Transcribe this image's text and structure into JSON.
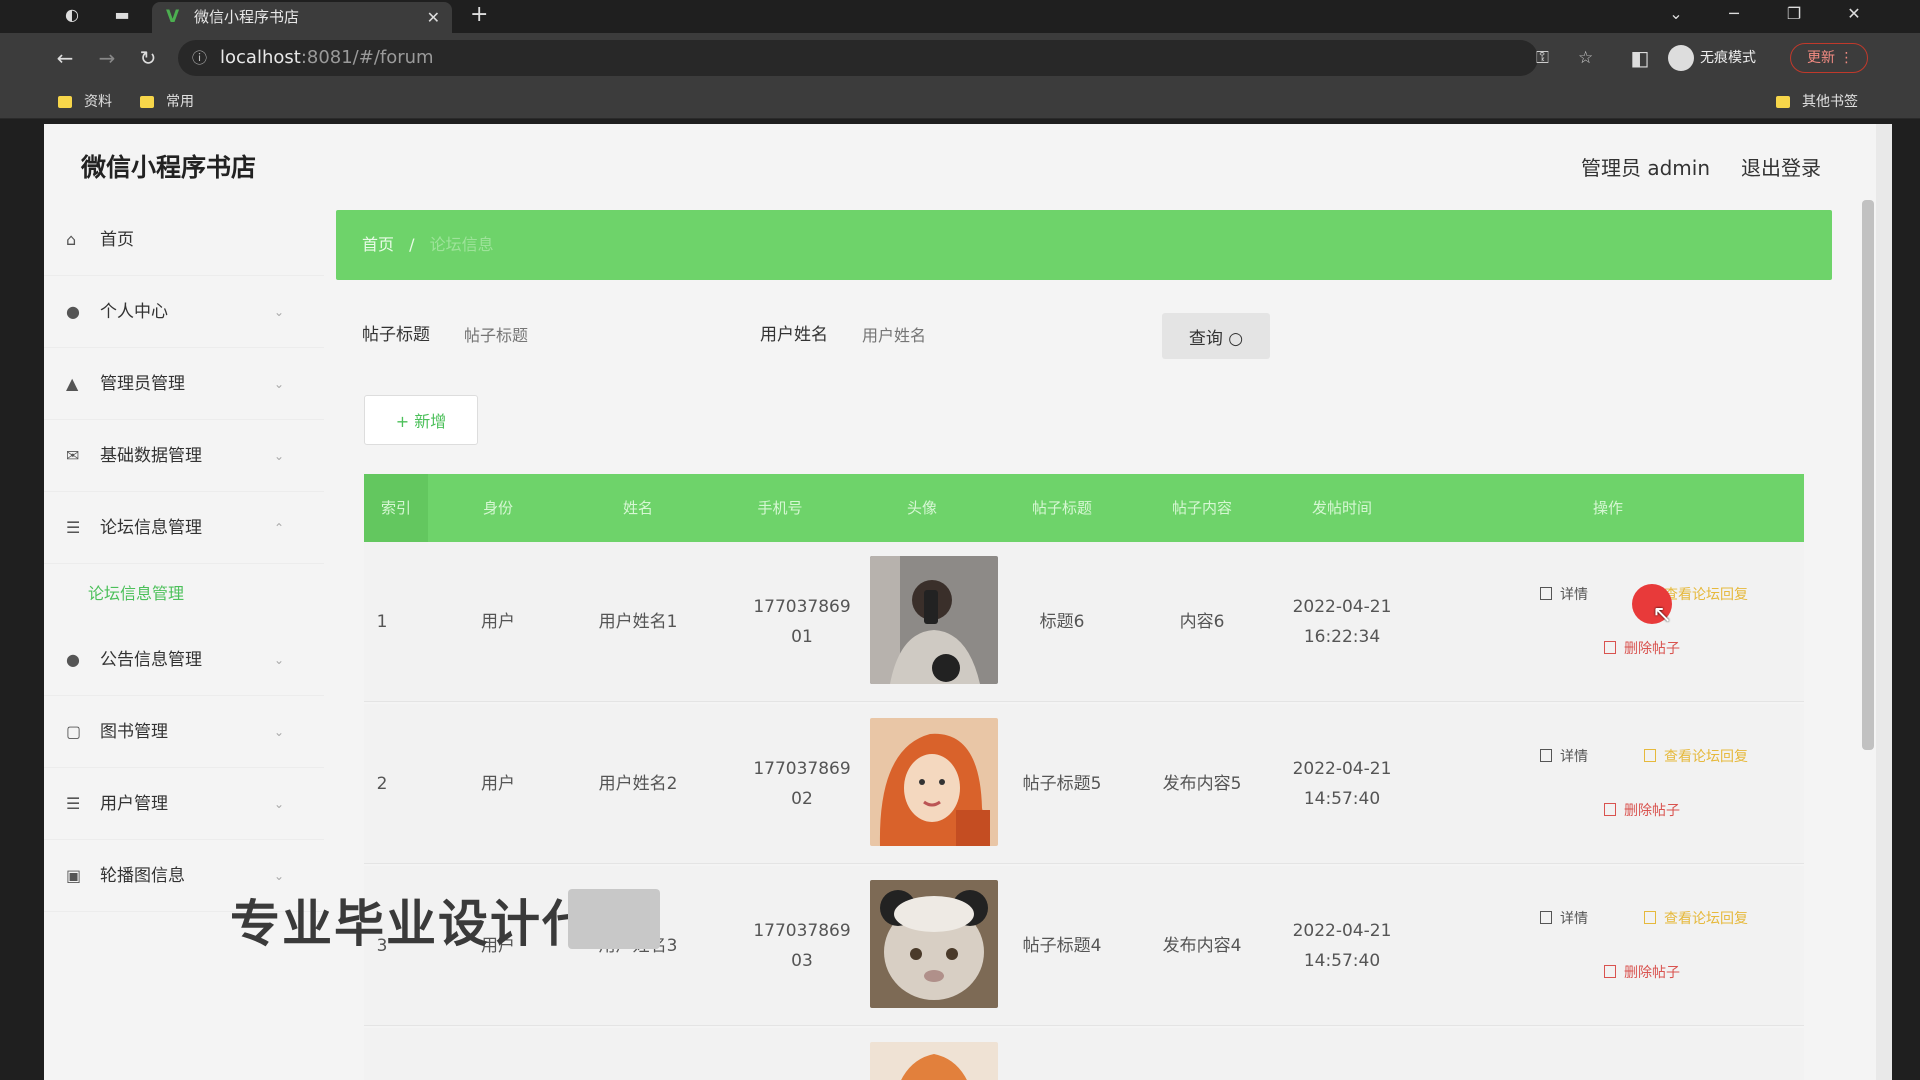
{
  "browser": {
    "tab_title": "微信小程序书店",
    "url_host": "localhost",
    "url_rest": ":8081/#/forum",
    "incognito_label": "无痕模式",
    "update_label": "更新",
    "bookmarks": [
      "资料",
      "常用"
    ],
    "other_bookmarks": "其他书签"
  },
  "header": {
    "app_title": "微信小程序书店",
    "user": "管理员 admin",
    "logout": "退出登录"
  },
  "sidebar": {
    "items": [
      {
        "label": "首页",
        "icon": "home-icon"
      },
      {
        "label": "个人中心",
        "icon": "person-icon"
      },
      {
        "label": "管理员管理",
        "icon": "admin-icon"
      },
      {
        "label": "基础数据管理",
        "icon": "mail-icon"
      },
      {
        "label": "论坛信息管理",
        "icon": "list-icon"
      },
      {
        "label": "公告信息管理",
        "icon": "person-icon"
      },
      {
        "label": "图书管理",
        "icon": "book-icon"
      },
      {
        "label": "用户管理",
        "icon": "list-icon"
      },
      {
        "label": "轮播图信息",
        "icon": "image-icon"
      }
    ],
    "active_submenu": "论坛信息管理"
  },
  "breadcrumb": {
    "home": "首页",
    "separator": "/",
    "current": "论坛信息"
  },
  "filters": {
    "title_label": "帖子标题",
    "title_placeholder": "帖子标题",
    "user_label": "用户姓名",
    "user_placeholder": "用户姓名",
    "query_button": "查询"
  },
  "add_button": "+ 新增",
  "table": {
    "headers": [
      "索引",
      "身份",
      "姓名",
      "手机号",
      "头像",
      "帖子标题",
      "帖子内容",
      "发帖时间",
      "操作"
    ],
    "rows": [
      {
        "index": "1",
        "role": "用户",
        "name": "用户姓名1",
        "phone": "17703786901",
        "title": "标题6",
        "content": "内容6",
        "date": "2022-04-21",
        "time": "16:22:34"
      },
      {
        "index": "2",
        "role": "用户",
        "name": "用户姓名2",
        "phone": "17703786902",
        "title": "帖子标题5",
        "content": "发布内容5",
        "date": "2022-04-21",
        "time": "14:57:40"
      },
      {
        "index": "3",
        "role": "用户",
        "name": "用户姓名3",
        "phone": "17703786903",
        "title": "帖子标题4",
        "content": "发布内容4",
        "date": "2022-04-21",
        "time": "14:57:40"
      }
    ],
    "ops": {
      "detail": "详情",
      "edit": "查看论坛回复",
      "delete": "删除帖子"
    }
  },
  "watermark": "专业毕业设计代做",
  "colors": {
    "accent": "#6ed36a",
    "sidebar_active": "#4cc05a",
    "edit": "#e6b93c",
    "delete": "#d9534f",
    "cursor_dot": "#e83a3a"
  }
}
